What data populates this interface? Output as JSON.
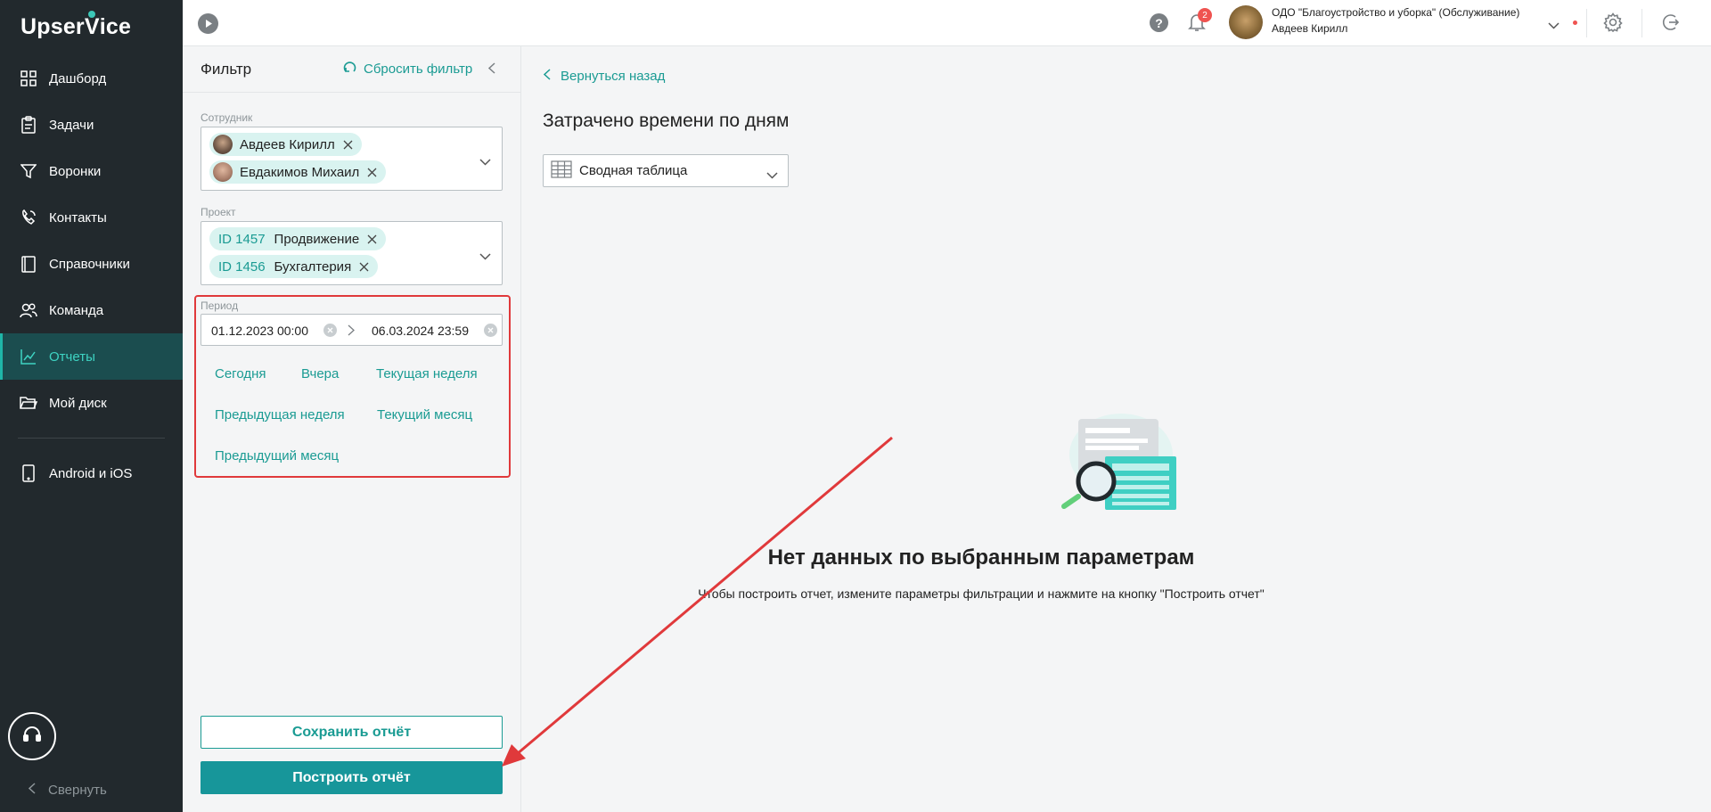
{
  "app": {
    "logo": "UpserVice"
  },
  "sidebar": {
    "items": [
      {
        "label": "Дашборд",
        "icon": "dashboard-icon"
      },
      {
        "label": "Задачи",
        "icon": "tasks-icon"
      },
      {
        "label": "Воронки",
        "icon": "funnel-icon"
      },
      {
        "label": "Контакты",
        "icon": "contacts-icon"
      },
      {
        "label": "Справочники",
        "icon": "book-icon"
      },
      {
        "label": "Команда",
        "icon": "team-icon"
      },
      {
        "label": "Отчеты",
        "icon": "chart-icon",
        "active": true
      },
      {
        "label": "Мой диск",
        "icon": "folder-icon"
      }
    ],
    "mobile": {
      "label": "Android и iOS",
      "icon": "phone-icon"
    },
    "collapse_label": "Свернуть"
  },
  "topbar": {
    "notifications_count": "2",
    "org_name": "ОДО \"Благоустройство и уборка\" (Обслуживание)",
    "user_name": "Авдеев Кирилл"
  },
  "filter": {
    "title": "Фильтр",
    "reset_label": "Сбросить фильтр",
    "employee": {
      "label": "Сотрудник",
      "chips": [
        "Авдеев Кирилл",
        "Евдакимов Михаил"
      ]
    },
    "project": {
      "label": "Проект",
      "chips": [
        {
          "id": "ID 1457",
          "name": "Продвижение"
        },
        {
          "id": "ID 1456",
          "name": "Бухгалтерия"
        }
      ]
    },
    "period": {
      "label": "Период",
      "start": "01.12.2023 00:00",
      "end": "06.03.2024 23:59",
      "presets": [
        "Сегодня",
        "Вчера",
        "Текущая неделя",
        "Предыдущая неделя",
        "Текущий месяц",
        "Предыдущий месяц"
      ]
    },
    "save_label": "Сохранить отчёт",
    "build_label": "Построить отчёт"
  },
  "main": {
    "back_label": "Вернуться назад",
    "title": "Затрачено времени по дням",
    "view_select": "Сводная таблица",
    "empty_title": "Нет данных по выбранным параметрам",
    "empty_subtitle": "Чтобы построить отчет, измените параметры фильтрации и нажмите на кнопку \"Построить отчет\""
  },
  "colors": {
    "accent": "#1a9b93",
    "sidebar_bg": "#22292d",
    "annotation": "#e0393b"
  }
}
